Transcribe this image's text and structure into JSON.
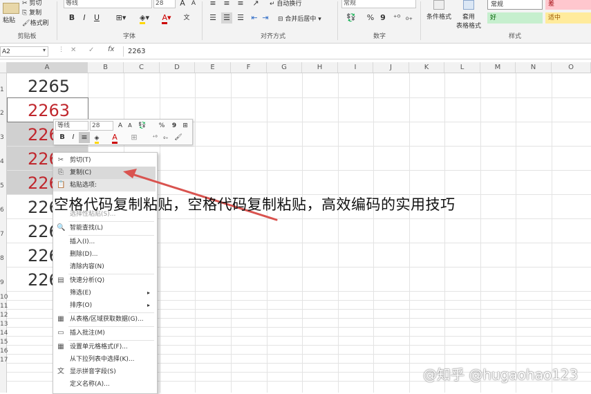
{
  "ribbon": {
    "clipboard": {
      "paste": "粘贴",
      "cut": "剪切",
      "copy": "复制",
      "format_painter": "格式刷",
      "label": "剪贴板"
    },
    "font": {
      "name": "等线",
      "size": "28",
      "grow": "A",
      "shrink": "A",
      "wen": "文",
      "bold": "B",
      "italic": "I",
      "underline": "U",
      "label": "字体"
    },
    "alignment": {
      "wrap": "自动换行",
      "merge": "合并后居中",
      "label": "对齐方式"
    },
    "number": {
      "format": "常规",
      "percent": "%",
      "comma": "9",
      "label": "数字"
    },
    "styles": {
      "conditional": "条件格式",
      "table1": "套用",
      "table2": "表格格式",
      "normal": "常规",
      "bad": "差",
      "good": "好",
      "neutral": "适中",
      "label": "样式"
    }
  },
  "formula_bar": {
    "name_box": "A2",
    "cancel": "✕",
    "enter": "✓",
    "fx": "fx",
    "value": "2263"
  },
  "columns": [
    "A",
    "B",
    "C",
    "D",
    "E",
    "F",
    "G",
    "H",
    "I",
    "J",
    "K",
    "L",
    "M",
    "N",
    "O"
  ],
  "rows": [
    "1",
    "2",
    "3",
    "4",
    "5",
    "6",
    "7",
    "8",
    "9",
    "10",
    "11",
    "12",
    "13",
    "14",
    "15",
    "16",
    "17"
  ],
  "cells": {
    "a1": "2265",
    "a2": "2263",
    "a3": "226",
    "a4": "226",
    "a5": "226",
    "a6": "226",
    "a7": "226",
    "a8": "226",
    "a9": "226"
  },
  "mini_toolbar": {
    "font": "等线",
    "size": "28",
    "grow": "A",
    "shrink": "A",
    "percent": "%",
    "comma": "9",
    "bold": "B",
    "italic": "I",
    "font_color": "A"
  },
  "context_menu": {
    "cut": "剪切(T)",
    "copy": "复制(C)",
    "paste_options": "粘贴选项:",
    "paste_special": "选择性粘贴(S)...",
    "smart_lookup": "智能查找(L)",
    "insert": "插入(I)...",
    "delete": "删除(D)...",
    "clear": "清除内容(N)",
    "quick_analysis": "快速分析(Q)",
    "filter": "筛选(E)",
    "sort": "排序(O)",
    "get_data": "从表格/区域获取数据(G)...",
    "insert_comment": "插入批注(M)",
    "format_cells": "设置单元格格式(F)...",
    "pick_list": "从下拉列表中选择(K)...",
    "phonetic": "显示拼音字段(S)",
    "define_name": "定义名称(A)..."
  },
  "overlay_title": "空格代码复制粘贴，空格代码复制粘贴，高效编码的实用技巧",
  "watermark": "@知乎 @hugaohao123",
  "colors": {
    "red_value": "#c0272d",
    "arrow": "#d9534f",
    "bad_style_bg": "#ffc7ce",
    "good_style_bg": "#c6efce",
    "neutral_style_bg": "#ffeb9c"
  }
}
